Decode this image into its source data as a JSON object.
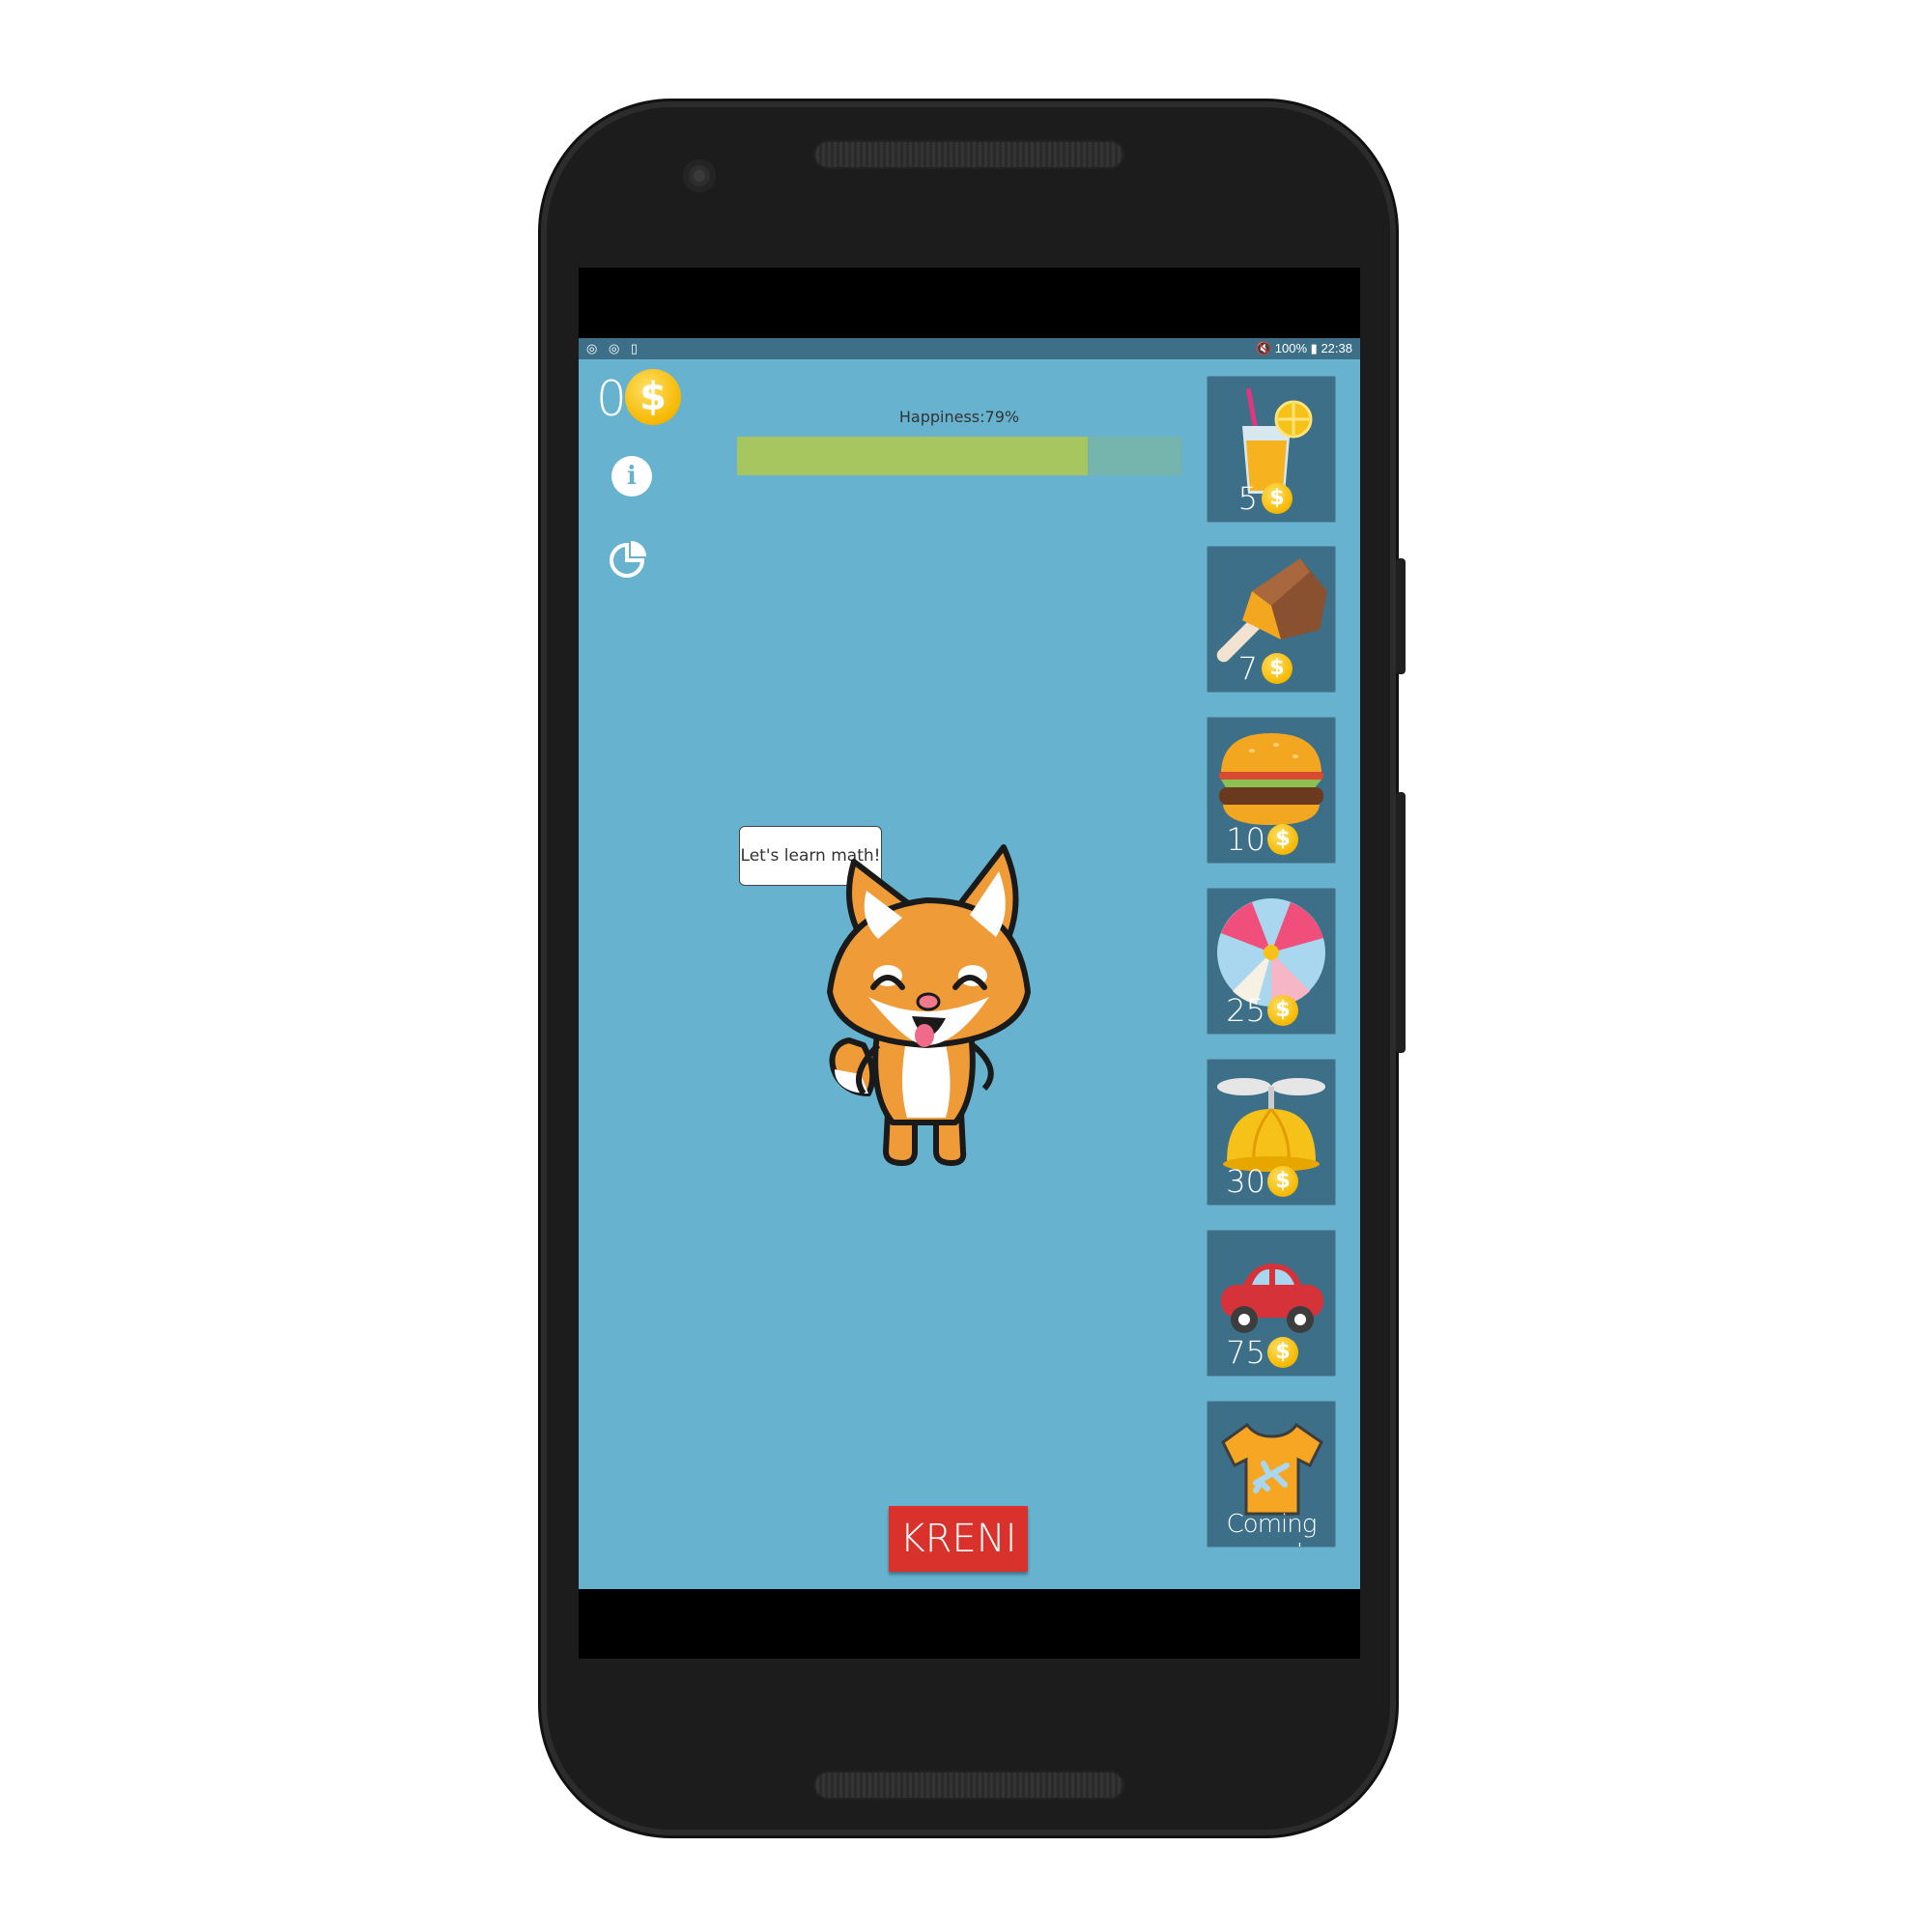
{
  "statusbar": {
    "left_icons": "◎ ◎ ▯",
    "right_text": "🔇 100% ▮ 22:38",
    "battery": "100%",
    "time": "22:38"
  },
  "header": {
    "coins": "0",
    "coin_symbol": "$",
    "happiness_label": "Happiness:79%",
    "happiness_value": 0.79
  },
  "bubble": {
    "text": "Let's learn math!"
  },
  "actions": {
    "start_label": "KRENI"
  },
  "shop": {
    "items": [
      {
        "icon": "lemonade-icon",
        "price": "5"
      },
      {
        "icon": "ice-cream-icon",
        "price": "7"
      },
      {
        "icon": "burger-icon",
        "price": "10"
      },
      {
        "icon": "beach-ball-icon",
        "price": "25"
      },
      {
        "icon": "propeller-hat-icon",
        "price": "30"
      },
      {
        "icon": "toy-car-icon",
        "price": "75"
      },
      {
        "icon": "tshirt-icon",
        "label": "Coming soon!"
      }
    ]
  },
  "colors": {
    "app_bg": "#67b3cf",
    "tile_bg": "#3d7088",
    "happiness_fill": "#a8c660",
    "start_button": "#d9322c"
  }
}
